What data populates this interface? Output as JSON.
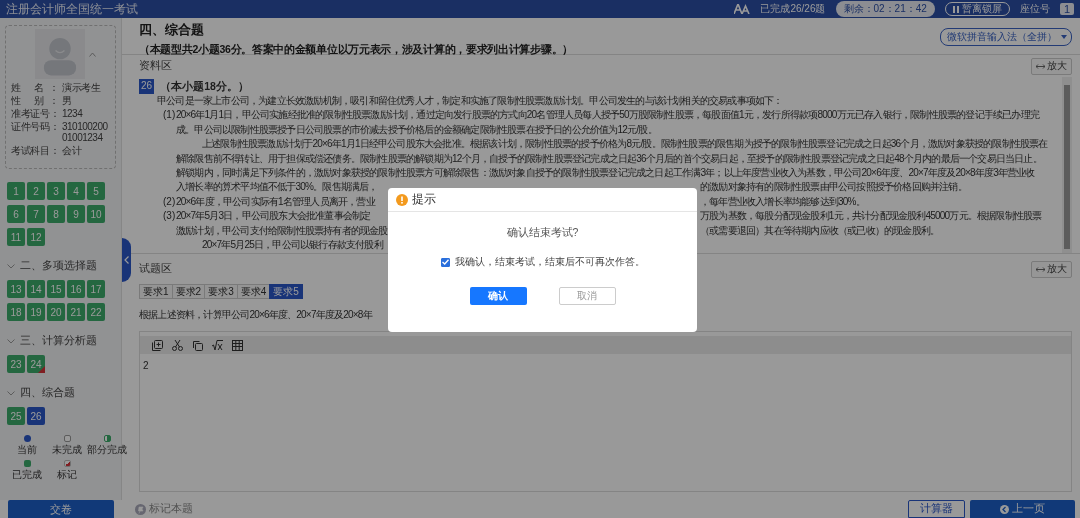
{
  "header": {
    "title": "注册会计师全国统一考试",
    "progress": "已完成26/26题",
    "timer": "剩余：02：21：42",
    "lock_button": "暂离锁屏",
    "seat_label": "座位号",
    "seat_number": "1"
  },
  "candidate": {
    "fields": [
      {
        "label": "姓 名：",
        "value": "演示考生"
      },
      {
        "label": "性 别：",
        "value": "男"
      },
      {
        "label": "准考证号：",
        "value": "1234"
      },
      {
        "label": "证件号码：",
        "value": "31010020001001234"
      },
      {
        "label": "考试科目：",
        "value": "会计"
      }
    ]
  },
  "sections": [
    {
      "questions": [
        {
          "number": "1",
          "answered": true,
          "selected": false,
          "flagged": false
        },
        {
          "number": "2",
          "answered": true,
          "selected": false,
          "flagged": false
        },
        {
          "number": "3",
          "answered": true,
          "selected": false,
          "flagged": false
        },
        {
          "number": "4",
          "answered": true,
          "selected": false,
          "flagged": false
        },
        {
          "number": "5",
          "answered": true,
          "selected": false,
          "flagged": false
        },
        {
          "number": "6",
          "answered": true,
          "selected": false,
          "flagged": false
        },
        {
          "number": "7",
          "answered": true,
          "selected": false,
          "flagged": false
        },
        {
          "number": "8",
          "answered": true,
          "selected": false,
          "flagged": false
        },
        {
          "number": "9",
          "answered": true,
          "selected": false,
          "flagged": false
        },
        {
          "number": "10",
          "answered": true,
          "selected": false,
          "flagged": false
        },
        {
          "number": "11",
          "answered": true,
          "selected": false,
          "flagged": false
        },
        {
          "number": "12",
          "answered": true,
          "selected": false,
          "flagged": false
        }
      ]
    },
    {
      "title": "二、多项选择题",
      "expanded": true,
      "questions": [
        {
          "number": "13",
          "answered": true,
          "selected": false,
          "flagged": false
        },
        {
          "number": "14",
          "answered": true,
          "selected": false,
          "flagged": false
        },
        {
          "number": "15",
          "answered": true,
          "selected": false,
          "flagged": false
        },
        {
          "number": "16",
          "answered": true,
          "selected": false,
          "flagged": false
        },
        {
          "number": "17",
          "answered": true,
          "selected": false,
          "flagged": false
        },
        {
          "number": "18",
          "answered": true,
          "selected": false,
          "flagged": false
        },
        {
          "number": "19",
          "answered": true,
          "selected": false,
          "flagged": false
        },
        {
          "number": "20",
          "answered": true,
          "selected": false,
          "flagged": false
        },
        {
          "number": "21",
          "answered": true,
          "selected": false,
          "flagged": false
        },
        {
          "number": "22",
          "answered": true,
          "selected": false,
          "flagged": false
        }
      ]
    },
    {
      "title": "三、计算分析题",
      "expanded": true,
      "questions": [
        {
          "number": "23",
          "answered": true,
          "selected": false,
          "flagged": false
        },
        {
          "number": "24",
          "answered": true,
          "selected": false,
          "flagged": true
        }
      ]
    },
    {
      "title": "四、综合题",
      "expanded": true,
      "questions": [
        {
          "number": "25",
          "answered": true,
          "selected": false,
          "flagged": false
        },
        {
          "number": "26",
          "selected": true,
          "flagged": false
        }
      ]
    }
  ],
  "legend": [
    {
      "kind": "current",
      "label": "当前"
    },
    {
      "kind": "undone",
      "label": "未完成"
    },
    {
      "kind": "partial",
      "label": "部分完成"
    },
    {
      "kind": "done",
      "label": "已完成"
    },
    {
      "kind": "flagged",
      "label": "标记"
    }
  ],
  "footer": {
    "submit_button": "交卷",
    "flag_button": "标记本题",
    "calculator_button": "计算器",
    "prev_button": "上一页"
  },
  "part": {
    "title": "四、综合题",
    "note": "（本题型共2小题36分。答案中的金额单位以万元表示，涉及计算的，要求列出计算步骤。）",
    "ime": "微软拼音输入法（全拼）"
  },
  "material": {
    "label": "资料区",
    "zoom_button": "放大",
    "number": "26",
    "score": "（本小题18分。）",
    "lines": [
      {
        "kind": "para",
        "text": "甲公司是一家上市公司，为建立长效激励机制，吸引和留住优秀人才，制定和实施了限制性股票激励计划。甲公司发生的与该计划相关的交易或事项如下："
      },
      {
        "kind": "item",
        "label": "(1)",
        "text": "20×6年1月1日，甲公司实施经批准的限制性股票激励计划，通过定向发行股票的方式向20名管理人员每人授予50万股限制性股票，每股面值1元，发行所得款项8000万元已存入银行，限制性股票的登记手续已办理完"
      },
      {
        "kind": "cont",
        "text": "成。甲公司以限制性股票授予日公司股票的市价减去授予价格后的金额确定限制性股票在授予日的公允价值为12元/股。"
      },
      {
        "kind": "indent",
        "text": "上述限制性股票激励计划于20×6年1月1日经甲公司股东大会批准。根据该计划，限制性股票的授予价格为8元/股。限制性股票的限售期为授予的限制性股票登记完成之日起36个月，激励对象获授的限制性股票在"
      },
      {
        "kind": "cont",
        "text": "解除限售前不得转让、用于担保或偿还债务。限制性股票的解锁期为12个月，自授予的限制性股票登记完成之日起36个月后的首个交易日起，至授予的限制性股票登记完成之日起48个月内的最后一个交易日当日止。"
      },
      {
        "kind": "cont",
        "text": "解锁期内，同时满足下列条件的，激励对象获授的限制性股票方可解除限售：激励对象自授予的限制性股票登记完成之日起工作满3年；以上年度营业收入为基数，甲公司20×6年度、20×7年度及20×8年度3年营业收"
      },
      {
        "kind": "cont",
        "text": "入增长率的算术平均值不低于30%。限售期满后，",
        "text_right": "的激励对象持有的限制性股票由甲公司按照授予价格回购并注销。"
      },
      {
        "kind": "item",
        "label": "(2)",
        "text": "20×6年度，甲公司实际有1名管理人员离开，营业",
        "text_right": "，每年营业收入增长率均能够达到30%。"
      },
      {
        "kind": "item",
        "label": "(3)",
        "text": "20×7年5月3日，甲公司股东大会批准董事会制定",
        "text_right": "万股为基数，每股分配现金股利1元，共计分配现金股利45000万元。根据限制性股票"
      },
      {
        "kind": "cont",
        "text": "激励计划，甲公司支付给限制性股票持有者的现金股",
        "text_right": "（或需要退回）其在等待期内应收（或已收）的现金股利。"
      },
      {
        "kind": "indent",
        "text": "20×7年5月25日，甲公司以银行存款支付股利"
      }
    ]
  },
  "question_area": {
    "label": "试题区",
    "zoom_button": "放大",
    "tabs": [
      {
        "label": "要求1",
        "selected": false
      },
      {
        "label": "要求2",
        "selected": false
      },
      {
        "label": "要求3",
        "selected": false
      },
      {
        "label": "要求4",
        "selected": false
      },
      {
        "label": "要求5",
        "selected": true
      }
    ],
    "question_text": "根据上述资料，计算甲公司20×6年度、20×7年度及20×8年",
    "answer": "2"
  },
  "dialog": {
    "title": "提示",
    "message": "确认结束考试?",
    "confirm": {
      "label": "我确认，结束考试，结束后不可再次作答。",
      "checked": true
    },
    "buttons": [
      {
        "label": "确认",
        "kind": "primary"
      },
      {
        "label": "取消",
        "kind": "secondary"
      }
    ]
  }
}
